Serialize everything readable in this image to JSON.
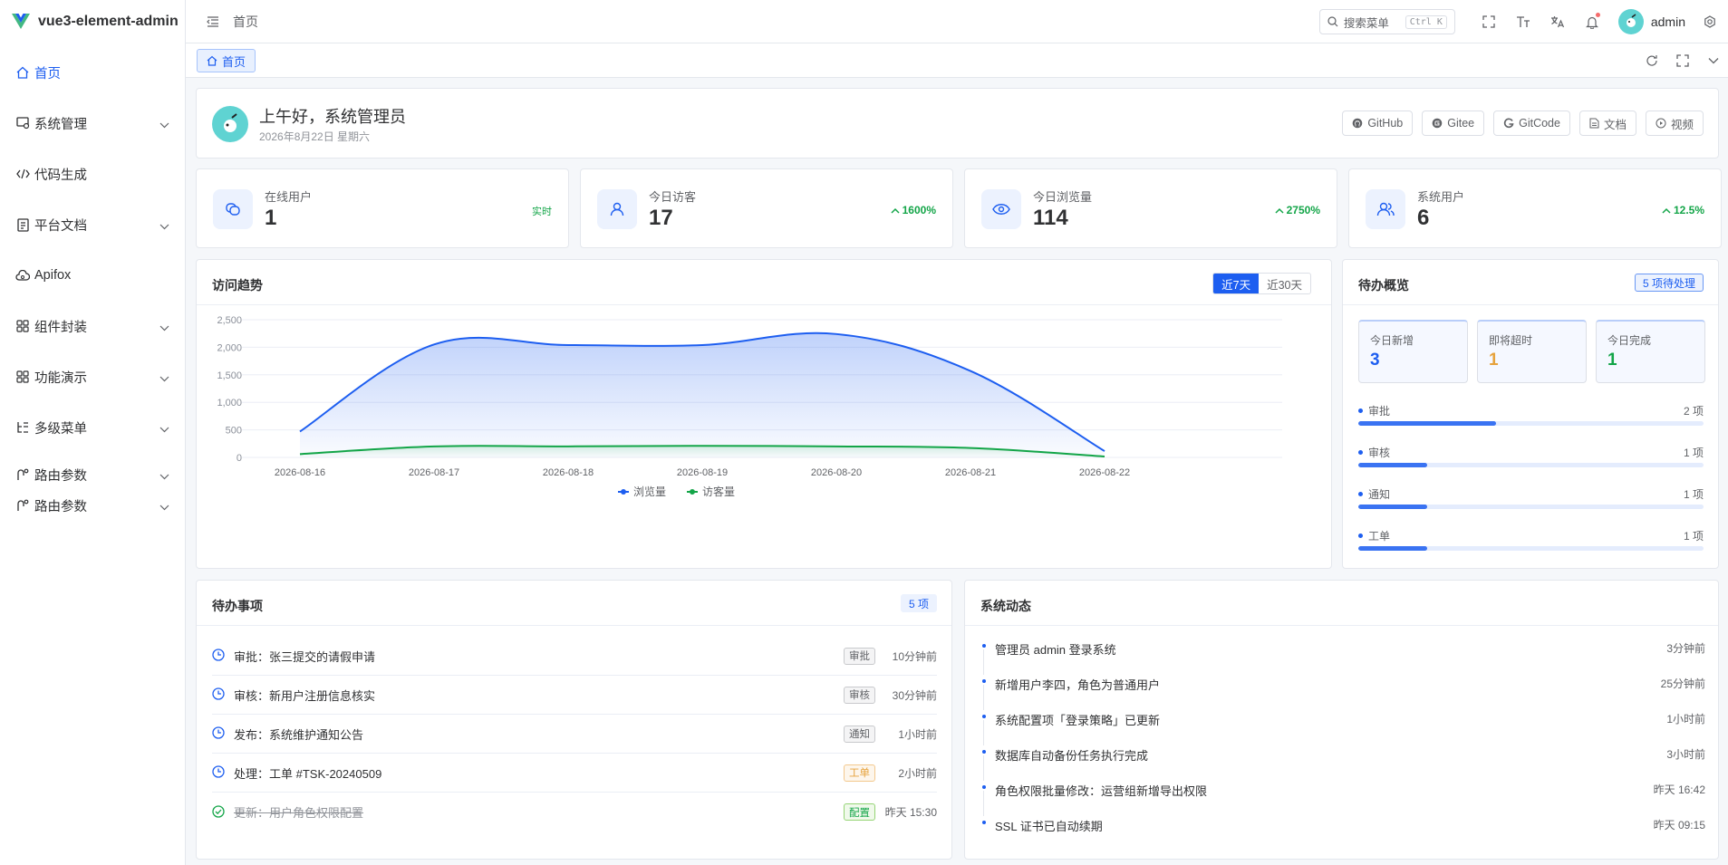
{
  "app": {
    "name": "vue3-element-admin"
  },
  "sidebar": {
    "items": [
      {
        "label": "首页",
        "icon": "home-icon",
        "active": true,
        "expandable": false
      },
      {
        "label": "系统管理",
        "icon": "system-icon",
        "active": false,
        "expandable": true
      },
      {
        "label": "代码生成",
        "icon": "code-icon",
        "active": false,
        "expandable": false
      },
      {
        "label": "平台文档",
        "icon": "document-icon",
        "active": false,
        "expandable": true
      },
      {
        "label": "Apifox",
        "icon": "cloud-icon",
        "active": false,
        "expandable": false
      },
      {
        "label": "组件封装",
        "icon": "grid-icon",
        "active": false,
        "expandable": true
      },
      {
        "label": "功能演示",
        "icon": "grid-icon",
        "active": false,
        "expandable": true
      },
      {
        "label": "多级菜单",
        "icon": "tree-icon",
        "active": false,
        "expandable": true
      },
      {
        "label": "路由参数",
        "icon": "route-icon",
        "active": false,
        "expandable": true
      },
      {
        "label": "路由参数",
        "icon": "route-icon",
        "active": false,
        "expandable": true
      }
    ]
  },
  "header": {
    "breadcrumb": "首页",
    "search_placeholder": "搜索菜单",
    "search_shortcut": "Ctrl K",
    "username": "admin"
  },
  "tags": {
    "current": "首页"
  },
  "welcome": {
    "greeting": "上午好，系统管理员",
    "date": "2026年8月22日 星期六",
    "links": [
      "GitHub",
      "Gitee",
      "GitCode",
      "文档",
      "视频"
    ]
  },
  "stats": [
    {
      "label": "在线用户",
      "value": "1",
      "badge": "实时",
      "live": true
    },
    {
      "label": "今日访客",
      "value": "17",
      "badge": "1600%",
      "live": false
    },
    {
      "label": "今日浏览量",
      "value": "114",
      "badge": "2750%",
      "live": false
    },
    {
      "label": "系统用户",
      "value": "6",
      "badge": "12.5%",
      "live": false
    }
  ],
  "trend": {
    "title": "访问趋势",
    "ranges": [
      "近7天",
      "近30天"
    ],
    "active_range": "近7天"
  },
  "chart_data": {
    "type": "area",
    "x": [
      "2026-08-16",
      "2026-08-17",
      "2026-08-18",
      "2026-08-19",
      "2026-08-20",
      "2026-08-21",
      "2026-08-22"
    ],
    "ylim": [
      0,
      2500
    ],
    "yticks": [
      "0",
      "500",
      "1,000",
      "1,500",
      "2,000",
      "2,500"
    ],
    "series": [
      {
        "name": "浏览量",
        "color": "#1d5ef0",
        "values": [
          470,
          2050,
          2040,
          2040,
          2240,
          1570,
          114
        ]
      },
      {
        "name": "访客量",
        "color": "#13a548",
        "values": [
          60,
          200,
          200,
          210,
          200,
          170,
          17
        ]
      }
    ],
    "legend": "bottom"
  },
  "overview": {
    "title": "待办概览",
    "pending": "5 项待处理",
    "boxes": [
      {
        "label": "今日新增",
        "value": "3",
        "color": "#1d5ef0"
      },
      {
        "label": "即将超时",
        "value": "1",
        "color": "#e6a23c"
      },
      {
        "label": "今日完成",
        "value": "1",
        "color": "#13a548"
      }
    ],
    "bars": [
      {
        "label": "审批",
        "count": "2 项",
        "fraction": 0.4
      },
      {
        "label": "审核",
        "count": "1 项",
        "fraction": 0.2
      },
      {
        "label": "通知",
        "count": "1 项",
        "fraction": 0.2
      },
      {
        "label": "工单",
        "count": "1 项",
        "fraction": 0.2
      }
    ]
  },
  "todos": {
    "title": "待办事项",
    "count": "5 项",
    "items": [
      {
        "text": "审批：张三提交的请假申请",
        "tag": "审批",
        "tag_type": "info",
        "time": "10分钟前",
        "done": false
      },
      {
        "text": "审核：新用户注册信息核实",
        "tag": "审核",
        "tag_type": "info",
        "time": "30分钟前",
        "done": false
      },
      {
        "text": "发布：系统维护通知公告",
        "tag": "通知",
        "tag_type": "info",
        "time": "1小时前",
        "done": false
      },
      {
        "text": "处理：工单 #TSK-20240509",
        "tag": "工单",
        "tag_type": "warn",
        "time": "2小时前",
        "done": false
      },
      {
        "text": "更新：用户角色权限配置",
        "tag": "配置",
        "tag_type": "ok",
        "time": "昨天 15:30",
        "done": true
      }
    ]
  },
  "activity": {
    "title": "系统动态",
    "items": [
      {
        "text": "管理员 admin 登录系统",
        "time": "3分钟前"
      },
      {
        "text": "新增用户李四，角色为普通用户",
        "time": "25分钟前"
      },
      {
        "text": "系统配置项「登录策略」已更新",
        "time": "1小时前"
      },
      {
        "text": "数据库自动备份任务执行完成",
        "time": "3小时前"
      },
      {
        "text": "角色权限批量修改：运营组新增导出权限",
        "time": "昨天 16:42"
      },
      {
        "text": "SSL 证书已自动续期",
        "time": "昨天 09:15"
      }
    ]
  }
}
